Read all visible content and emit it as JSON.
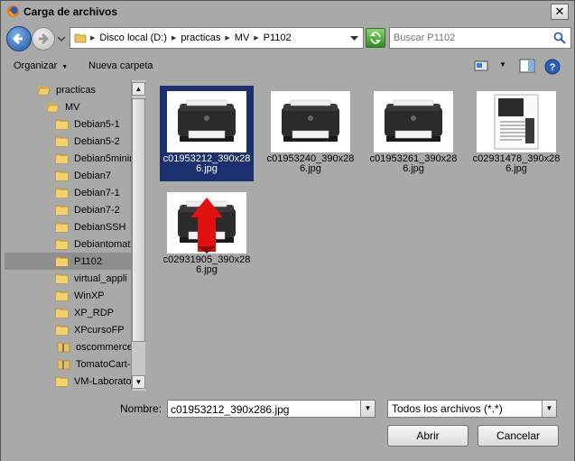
{
  "window": {
    "title": "Carga de archivos",
    "close_label": "✕"
  },
  "address": {
    "crumbs": [
      "Disco local (D:)",
      "practicas",
      "MV",
      "P1102"
    ],
    "search_placeholder": "Buscar P1102"
  },
  "toolbar": {
    "organize": "Organizar",
    "new_folder": "Nueva carpeta"
  },
  "sidebar": {
    "items": [
      {
        "label": "practicas",
        "type": "folder-open"
      },
      {
        "label": "MV",
        "type": "folder-open"
      },
      {
        "label": "Debian5-1",
        "type": "folder"
      },
      {
        "label": "Debian5-2",
        "type": "folder"
      },
      {
        "label": "Debian5minim",
        "type": "folder"
      },
      {
        "label": "Debian7",
        "type": "folder"
      },
      {
        "label": "Debian7-1",
        "type": "folder"
      },
      {
        "label": "Debian7-2",
        "type": "folder"
      },
      {
        "label": "DebianSSH",
        "type": "folder"
      },
      {
        "label": "Debiantomat",
        "type": "folder"
      },
      {
        "label": "P1102",
        "type": "folder",
        "selected": true
      },
      {
        "label": "virtual_appli",
        "type": "folder"
      },
      {
        "label": "WinXP",
        "type": "folder"
      },
      {
        "label": "XP_RDP",
        "type": "folder"
      },
      {
        "label": "XPcursoFP",
        "type": "folder"
      },
      {
        "label": "oscommerce-",
        "type": "zip"
      },
      {
        "label": "TomatoCart-",
        "type": "zip"
      },
      {
        "label": "VM-Laborato",
        "type": "folder"
      }
    ]
  },
  "files": [
    {
      "name": "c01953212_390x286.jpg",
      "line1": "c01953212_390x28",
      "line2": "6.jpg",
      "kind": "printer",
      "selected": true
    },
    {
      "name": "c01953240_390x286.jpg",
      "line1": "c01953240_390x28",
      "line2": "6.jpg",
      "kind": "printer"
    },
    {
      "name": "c01953261_390x286.jpg",
      "line1": "c01953261_390x28",
      "line2": "6.jpg",
      "kind": "printer"
    },
    {
      "name": "c02931478_390x286.jpg",
      "line1": "c02931478_390x28",
      "line2": "6.jpg",
      "kind": "manual"
    },
    {
      "name": "c02931905_390x286.jpg",
      "line1": "c02931905_390x28",
      "line2": "6.jpg",
      "kind": "printer-arrow"
    }
  ],
  "bottom": {
    "name_label": "Nombre:",
    "name_value": "c01953212_390x286.jpg",
    "filter": "Todos los archivos (*.*)",
    "open": "Abrir",
    "cancel": "Cancelar"
  },
  "colors": {
    "selection": "#1c2f6e",
    "window_bg": "#a9a9a9",
    "arrow_red": "#e01010"
  }
}
